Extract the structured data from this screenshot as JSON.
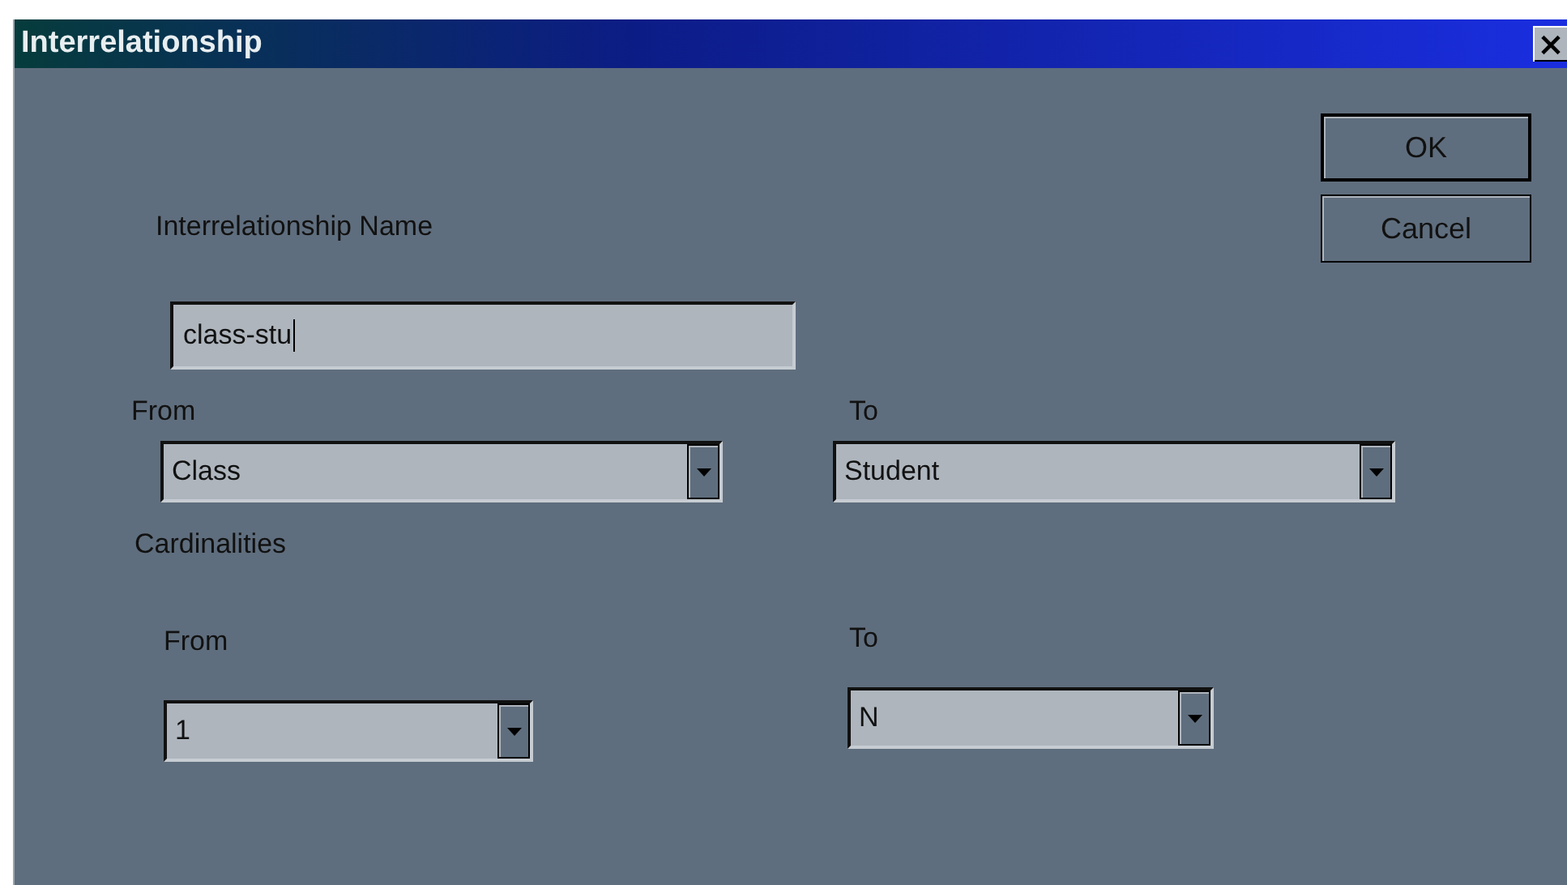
{
  "window": {
    "title": "Interrelationship",
    "close": "×"
  },
  "name_field": {
    "label": "Interrelationship Name",
    "value": "class-stu",
    "focused": true
  },
  "relationship": {
    "from": {
      "label": "From",
      "value": "Class"
    },
    "to": {
      "label": "To",
      "value": "Student"
    }
  },
  "cardinalities": {
    "label": "Cardinalities",
    "from": {
      "label": "From",
      "value": "1"
    },
    "to": {
      "label": "To",
      "value": "N"
    }
  },
  "buttons": [
    {
      "label": "OK",
      "default": true
    },
    {
      "label": "Cancel",
      "default": false
    }
  ]
}
